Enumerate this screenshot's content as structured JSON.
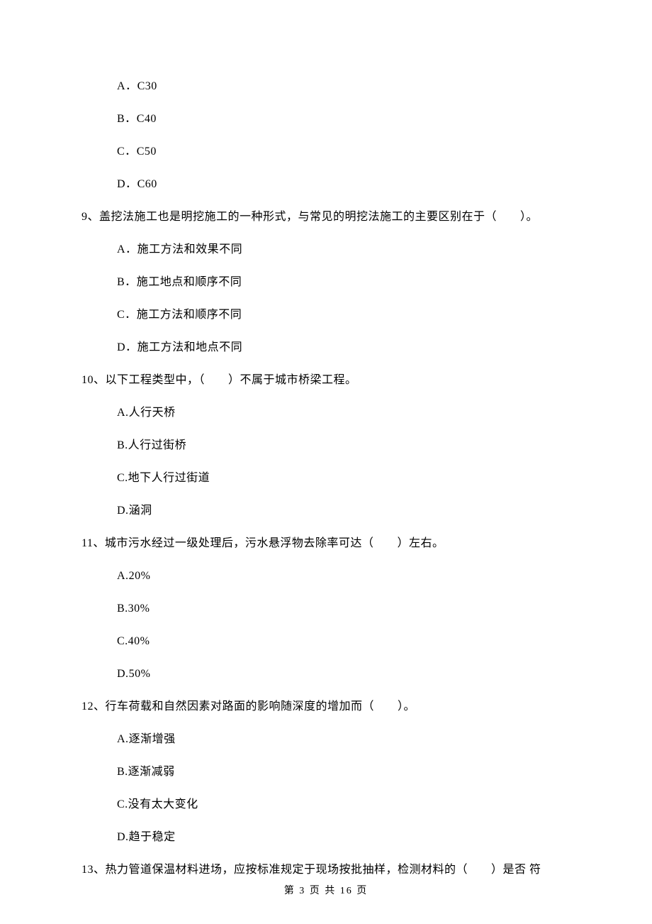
{
  "options_prev": [
    {
      "letter": "A．",
      "text": "C30"
    },
    {
      "letter": "B．",
      "text": "C40"
    },
    {
      "letter": "C．",
      "text": "C50"
    },
    {
      "letter": "D．",
      "text": "C60"
    }
  ],
  "questions": [
    {
      "num": "9、",
      "text_before": "盖挖法施工也是明挖施工的一种形式，与常见的明挖法施工的主要区别在于（",
      "blank": "　　",
      "text_after": "）。",
      "options": [
        {
          "letter": "A．",
          "text": "施工方法和效果不同"
        },
        {
          "letter": "B．",
          "text": "施工地点和顺序不同"
        },
        {
          "letter": "C．",
          "text": "施工方法和顺序不同"
        },
        {
          "letter": "D．",
          "text": "施工方法和地点不同"
        }
      ]
    },
    {
      "num": "10、",
      "text_before": "以下工程类型中，（",
      "blank": "　　",
      "text_after": "）不属于城市桥梁工程。",
      "options": [
        {
          "letter": "A.",
          "text": "人行天桥"
        },
        {
          "letter": "B.",
          "text": "人行过街桥"
        },
        {
          "letter": "C.",
          "text": "地下人行过街道"
        },
        {
          "letter": "D.",
          "text": "涵洞"
        }
      ]
    },
    {
      "num": "11、",
      "text_before": "城市污水经过一级处理后，污水悬浮物去除率可达（",
      "blank": "　　",
      "text_after": "）左右。",
      "options": [
        {
          "letter": "A.",
          "text": "20%"
        },
        {
          "letter": "B.",
          "text": "30%"
        },
        {
          "letter": "C.",
          "text": "40%"
        },
        {
          "letter": "D.",
          "text": "50%"
        }
      ]
    },
    {
      "num": "12、",
      "text_before": "行车荷载和自然因素对路面的影响随深度的增加而（",
      "blank": "　　",
      "text_after": "）。",
      "options": [
        {
          "letter": "A.",
          "text": "逐渐增强"
        },
        {
          "letter": "B.",
          "text": "逐渐减弱"
        },
        {
          "letter": "C.",
          "text": "没有太大变化"
        },
        {
          "letter": "D.",
          "text": "趋于稳定"
        }
      ]
    },
    {
      "num": "13、",
      "text_before": "热力管道保温材料进场，应按标准规定于现场按批抽样，检测材料的（",
      "blank": "　　",
      "text_after": "）是否 符",
      "options": []
    }
  ],
  "footer": "第 3 页 共 16 页"
}
